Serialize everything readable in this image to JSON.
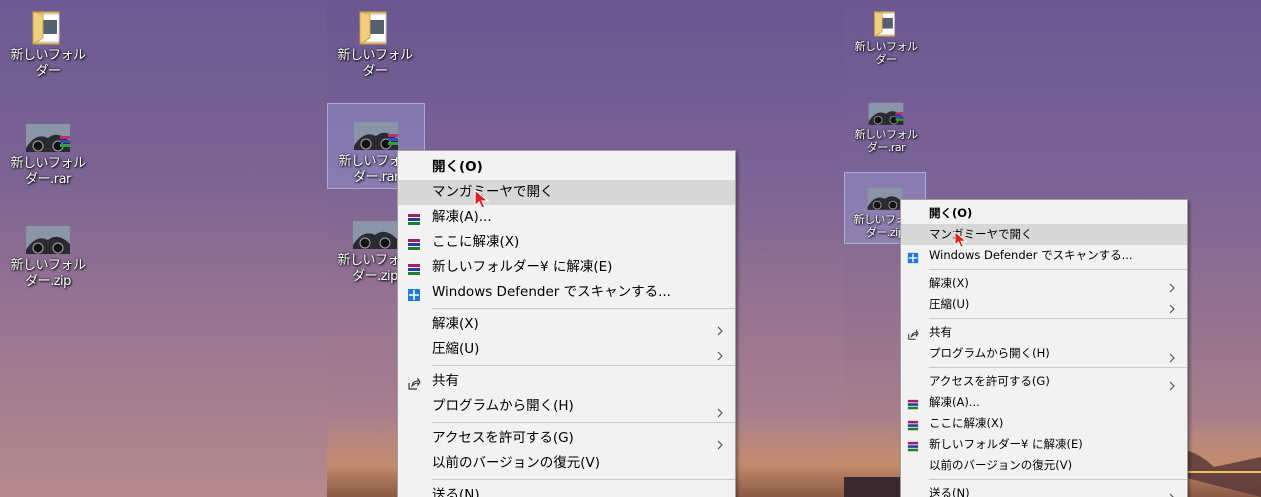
{
  "panel1": {
    "icons": [
      {
        "label": "新しいフォル\nダー",
        "type": "folder-icon"
      },
      {
        "label": "新しいフォル\nダー.rar",
        "type": "rar-archive-icon"
      },
      {
        "label": "新しいフォル\nダー.zip",
        "type": "zip-archive-icon"
      }
    ]
  },
  "panel2": {
    "icons": [
      {
        "label": "新しいフォル\nダー",
        "type": "folder-icon"
      },
      {
        "label": "新しいフォル\nダー.rar",
        "type": "rar-archive-icon"
      },
      {
        "label": "新しいフォル\nダー.zip",
        "type": "zip-archive-icon"
      }
    ],
    "menu": [
      {
        "label": "開く(O)",
        "bold": true
      },
      {
        "label": "マンガミーヤで開く",
        "highlight": true
      },
      {
        "label": "解凍(A)...",
        "icon": "winrar-icon"
      },
      {
        "label": "ここに解凍(X)",
        "icon": "winrar-icon"
      },
      {
        "label": "新しいフォルダー¥ に解凍(E)",
        "icon": "winrar-icon"
      },
      {
        "label": "Windows Defender でスキャンする...",
        "icon": "defender-icon"
      },
      {
        "separator": true
      },
      {
        "label": "解凍(X)",
        "submenu": true
      },
      {
        "label": "圧縮(U)",
        "submenu": true
      },
      {
        "separator": true
      },
      {
        "label": "共有",
        "icon": "share-icon"
      },
      {
        "label": "プログラムから開く(H)",
        "submenu": true
      },
      {
        "separator": true
      },
      {
        "label": "アクセスを許可する(G)",
        "submenu": true
      },
      {
        "label": "以前のバージョンの復元(V)"
      },
      {
        "separator": true
      },
      {
        "label": "送る(N)",
        "submenu": true
      }
    ]
  },
  "panel3": {
    "icons": [
      {
        "label": "新しいフォル\nダー",
        "type": "folder-icon"
      },
      {
        "label": "新しいフォル\nダー.rar",
        "type": "rar-archive-icon"
      },
      {
        "label": "新しいフォル\nダー.zip",
        "type": "zip-archive-icon"
      }
    ],
    "menu": [
      {
        "label": "開く(O)",
        "bold": true
      },
      {
        "label": "マンガミーヤで開く",
        "highlight": true
      },
      {
        "label": "Windows Defender でスキャンする...",
        "icon": "defender-icon"
      },
      {
        "separator": true
      },
      {
        "label": "解凍(X)",
        "submenu": true
      },
      {
        "label": "圧縮(U)",
        "submenu": true
      },
      {
        "separator": true
      },
      {
        "label": "共有",
        "icon": "share-icon"
      },
      {
        "label": "プログラムから開く(H)",
        "submenu": true
      },
      {
        "separator": true
      },
      {
        "label": "アクセスを許可する(G)",
        "submenu": true
      },
      {
        "label": "解凍(A)...",
        "icon": "winrar-icon"
      },
      {
        "label": "ここに解凍(X)",
        "icon": "winrar-icon"
      },
      {
        "label": "新しいフォルダー¥ に解凍(E)",
        "icon": "winrar-icon"
      },
      {
        "label": "以前のバージョンの復元(V)"
      },
      {
        "separator": true
      },
      {
        "label": "送る(N)",
        "submenu": true
      }
    ]
  }
}
